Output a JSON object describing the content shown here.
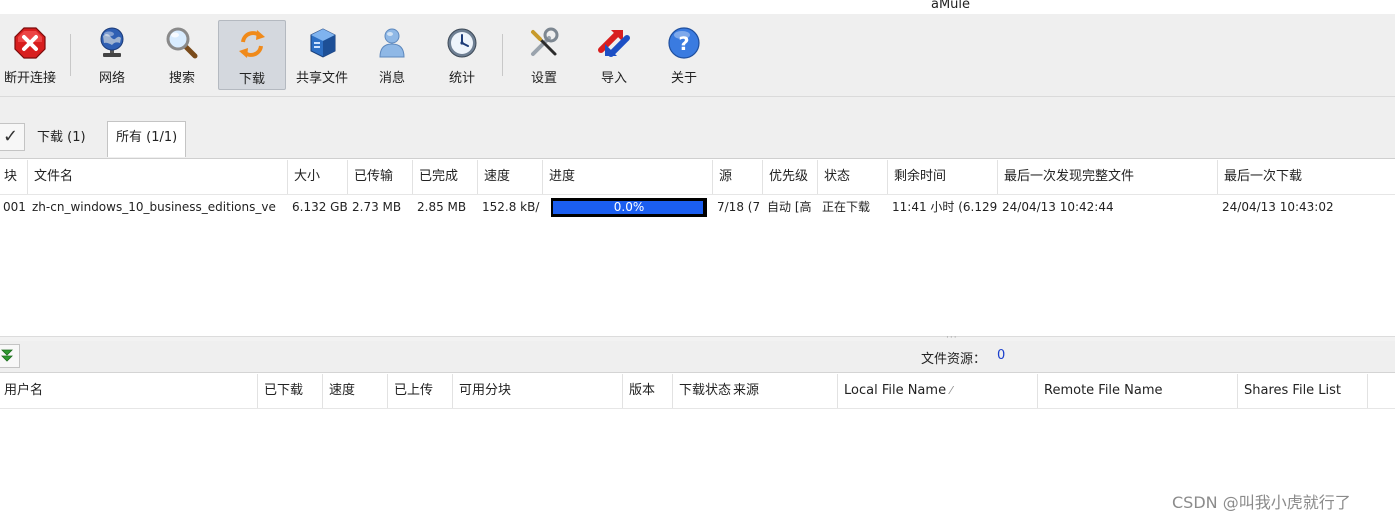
{
  "window": {
    "title": "aMule"
  },
  "toolbar": {
    "items": [
      {
        "label": "断开连接",
        "icon": "disconnect-icon"
      },
      {
        "label": "网络",
        "icon": "network-icon"
      },
      {
        "label": "搜索",
        "icon": "search-icon"
      },
      {
        "label": "下载",
        "icon": "download-icon",
        "active": true
      },
      {
        "label": "共享文件",
        "icon": "shared-files-icon"
      },
      {
        "label": "消息",
        "icon": "messages-icon"
      },
      {
        "label": "统计",
        "icon": "statistics-icon"
      },
      {
        "label": "设置",
        "icon": "settings-icon"
      },
      {
        "label": "导入",
        "icon": "import-icon"
      },
      {
        "label": "关于",
        "icon": "about-icon"
      }
    ]
  },
  "filter": {
    "check_glyph": "✓",
    "tabs": [
      {
        "label": "下载 (1)"
      },
      {
        "label": "所有 (1/1)",
        "selected": true
      }
    ]
  },
  "downloads": {
    "columns": [
      "块",
      "文件名",
      "大小",
      "已传输",
      "已完成",
      "速度",
      "进度",
      "源",
      "优先级",
      "状态",
      "剩余时间",
      "最后一次发现完整文件",
      "最后一次下载"
    ],
    "rows": [
      {
        "part": "001",
        "filename": "zh-cn_windows_10_business_editions_ve",
        "size": "6.132 GB",
        "transferred": "2.73 MB",
        "completed": "2.85 MB",
        "speed": "152.8 kB/",
        "progress_text": "0.0%",
        "progress_fraction": 0.0,
        "sources": "7/18 (7",
        "priority": "自动 [高",
        "status": "正在下载",
        "remaining": "11:41 小时 (6.129",
        "last_complete": "24/04/13 10:42:44",
        "last_download": "24/04/13 10:43:02"
      }
    ]
  },
  "sources_panel": {
    "label": "文件资源：",
    "count": "0",
    "columns": [
      "用户名",
      "已下载",
      "速度",
      "已上传",
      "可用分块",
      "版本",
      "下载状态",
      "来源",
      "Local File Name",
      "Remote File Name",
      "Shares File List"
    ]
  },
  "watermark": "CSDN @叫我小虎就行了",
  "colors": {
    "progress_fill": "#1b5ef0",
    "count_text": "#1a3fcc",
    "toolbar_bg": "#efefef"
  }
}
